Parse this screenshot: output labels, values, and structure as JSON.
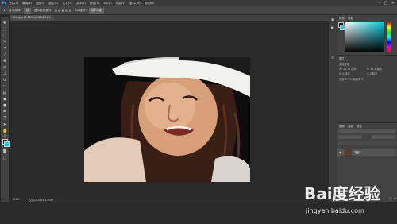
{
  "app": {
    "logo": "Ps"
  },
  "menubar": {
    "items": [
      "文件(F)",
      "编辑(E)",
      "图像(I)",
      "图层(L)",
      "文字(Y)",
      "选择(S)",
      "滤镜(T)",
      "3D(D)",
      "视图(V)",
      "窗口(W)",
      "帮助(H)"
    ]
  },
  "window_controls": {
    "minimize": "–",
    "maximize": "□",
    "close": "✕"
  },
  "options_bar": {
    "items": [
      "自动选择:",
      "组",
      "显示变换控件"
    ],
    "mode_3d": "3D 模式:"
  },
  "document": {
    "tab_title": "hhnjpg @ 100%(RGB/8#) ×"
  },
  "statusbar": {
    "zoom": "100%",
    "doc_info": "文档:1.03M/1.03M"
  },
  "panels": {
    "color_tabs": [
      "颜色",
      "色板"
    ],
    "properties_title": "属性",
    "properties_lines": [
      "文档属性",
      "W: 14.71 厘米",
      "H: 11.1 厘米",
      "X: 0 厘米",
      "Y: 0 厘米",
      "分辨率: 72 像素/英寸"
    ],
    "layers_tabs": [
      "图层",
      "通道",
      "路径"
    ],
    "layer_name": "背景"
  },
  "watermark": {
    "logo": "Bai度经验",
    "url": "jingyan.baidu.com"
  },
  "colors": {
    "foreground": "#1a1a1a",
    "background": "#26c6d9",
    "ui_dark": "#262626"
  }
}
